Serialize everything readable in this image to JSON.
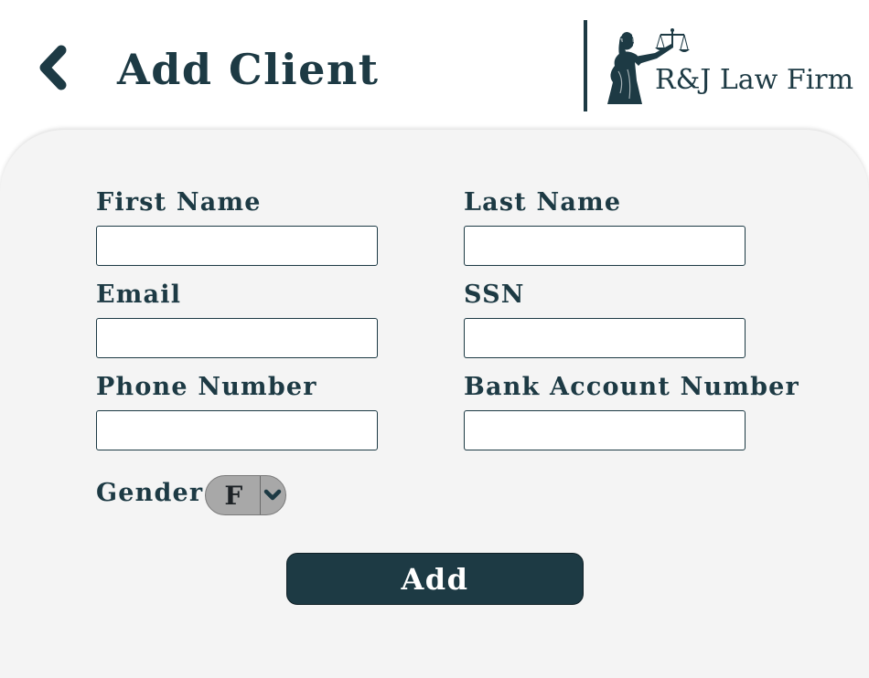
{
  "header": {
    "back_icon": "chevron-left-icon",
    "title": "Add Client",
    "logo_text": "R&J Law Firm",
    "logo_icon": "lady-justice-icon"
  },
  "form": {
    "first_name": {
      "label": "First Name",
      "value": "",
      "placeholder": ""
    },
    "last_name": {
      "label": "Last Name",
      "value": "",
      "placeholder": ""
    },
    "email": {
      "label": "Email",
      "value": "",
      "placeholder": ""
    },
    "ssn": {
      "label": "SSN",
      "value": "",
      "placeholder": ""
    },
    "phone": {
      "label": "Phone Number",
      "value": "",
      "placeholder": ""
    },
    "bank_account": {
      "label": "Bank Account Number",
      "value": "",
      "placeholder": ""
    },
    "gender": {
      "label": "Gender",
      "selected": "F",
      "arrow_icon": "chevron-down-icon"
    },
    "submit_label": "Add"
  },
  "colors": {
    "primary": "#1d3a44",
    "panel_background": "#f4f4f4",
    "select_background": "#a8a8a8",
    "button_text": "#ffffff"
  }
}
